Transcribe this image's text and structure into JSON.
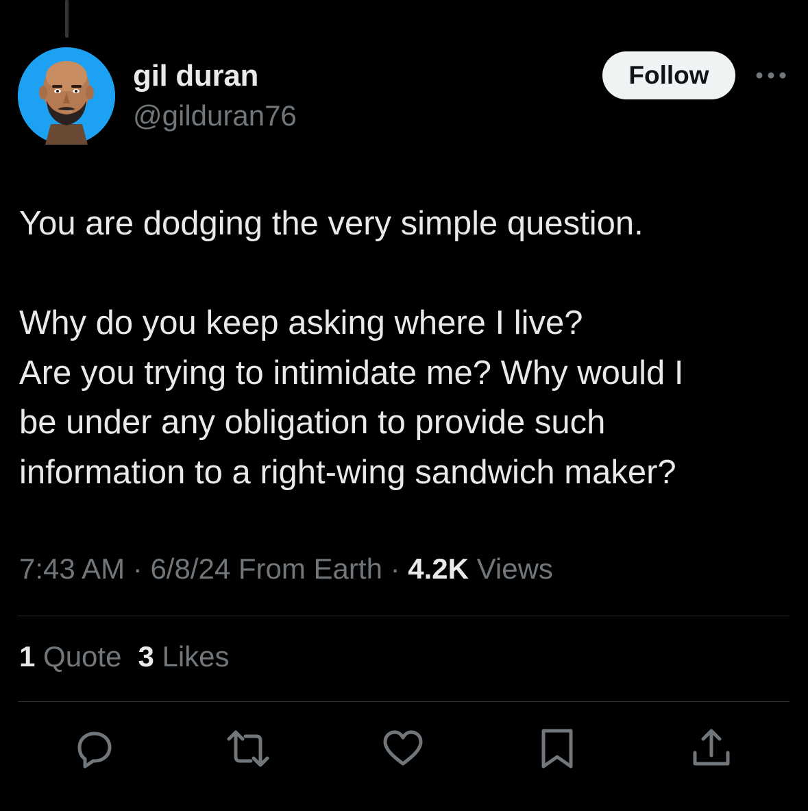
{
  "author": {
    "display_name": "gil duran",
    "handle": "@gilduran76"
  },
  "follow_button": {
    "label": "Follow"
  },
  "more_menu": {
    "icon": "more-horizontal-icon"
  },
  "tweet": {
    "lines": [
      "You are dodging the very simple question.",
      "",
      "Why do you keep asking where I live?",
      "Are you trying to intimidate me? Why would I",
      "be under any obligation to provide such",
      "information to a right-wing sandwich maker?"
    ]
  },
  "meta": {
    "time": "7:43 AM",
    "sep1": " · ",
    "date": "6/8/24",
    "location": " From Earth",
    "sep2": " · ",
    "views_count": "4.2K",
    "views_label": " Views"
  },
  "stats": {
    "quotes_count": "1",
    "quotes_label": " Quote",
    "likes_count": "3",
    "likes_label": " Likes"
  },
  "actions": [
    {
      "name": "reply",
      "icon": "reply-icon"
    },
    {
      "name": "repost",
      "icon": "repost-icon"
    },
    {
      "name": "like",
      "icon": "heart-icon"
    },
    {
      "name": "bookmark",
      "icon": "bookmark-icon"
    },
    {
      "name": "share",
      "icon": "share-icon"
    }
  ],
  "colors": {
    "background": "#000000",
    "primary_text": "#e7e9ea",
    "secondary_text": "#71767b",
    "divider": "#2f3336",
    "avatar_bg": "#1da1f2",
    "follow_bg": "#eff3f4"
  }
}
